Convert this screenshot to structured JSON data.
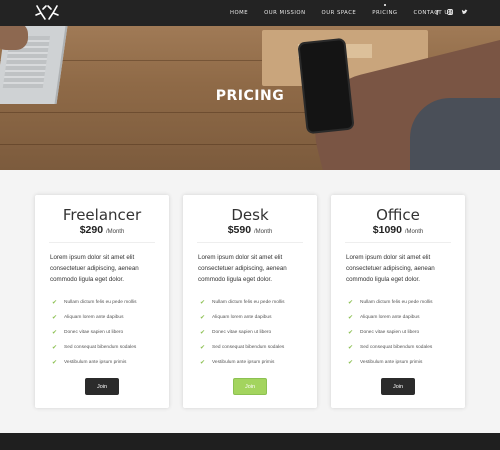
{
  "nav": {
    "items": [
      "HOME",
      "OUR MISSION",
      "OUR SPACE",
      "PRICING",
      "CONTACT US"
    ],
    "active_index": 3
  },
  "social": [
    {
      "icon": "facebook-icon",
      "glyph": "f"
    },
    {
      "icon": "instagram-icon",
      "glyph": "◙"
    },
    {
      "icon": "twitter-icon",
      "glyph": "♥"
    }
  ],
  "hero": {
    "title": "PRICING"
  },
  "colors": {
    "accent_green": "#8cc152",
    "dark_button": "#2b2b2b",
    "topbar": "#232323"
  },
  "plans": [
    {
      "name": "Freelancer",
      "price": "$290",
      "period": "/Month",
      "description": "Lorem ipsum dolor sit amet elit consectetuer adipiscing, aenean commodo ligula eget dolor.",
      "features": [
        "Nullam dictum felis eu pede mollis",
        "Aliquam lorem ante dapibus",
        "Donec vitae sapien ut libero",
        "Sed consequat bibendum sodales",
        "Vestibulum ante ipsum primis"
      ],
      "button": "Join",
      "button_style": "dark"
    },
    {
      "name": "Desk",
      "price": "$590",
      "period": "/Month",
      "description": "Lorem ipsum dolor sit amet elit consectetuer adipiscing, aenean commodo ligula eget dolor.",
      "features": [
        "Nullam dictum felis eu pede mollis",
        "Aliquam lorem ante dapibus",
        "Donec vitae sapien ut libero",
        "Sed consequat bibendum sodales",
        "Vestibulum ante ipsum primis"
      ],
      "button": "Join",
      "button_style": "green"
    },
    {
      "name": "Office",
      "price": "$1090",
      "period": "/Month",
      "description": "Lorem ipsum dolor sit amet elit consectetuer adipiscing, aenean commodo ligula eget dolor.",
      "features": [
        "Nullam dictum felis eu pede mollis",
        "Aliquam lorem ante dapibus",
        "Donec vitae sapien ut libero",
        "Sed consequat bibendum sodales",
        "Vestibulum ante ipsum primis"
      ],
      "button": "Join",
      "button_style": "dark"
    }
  ]
}
